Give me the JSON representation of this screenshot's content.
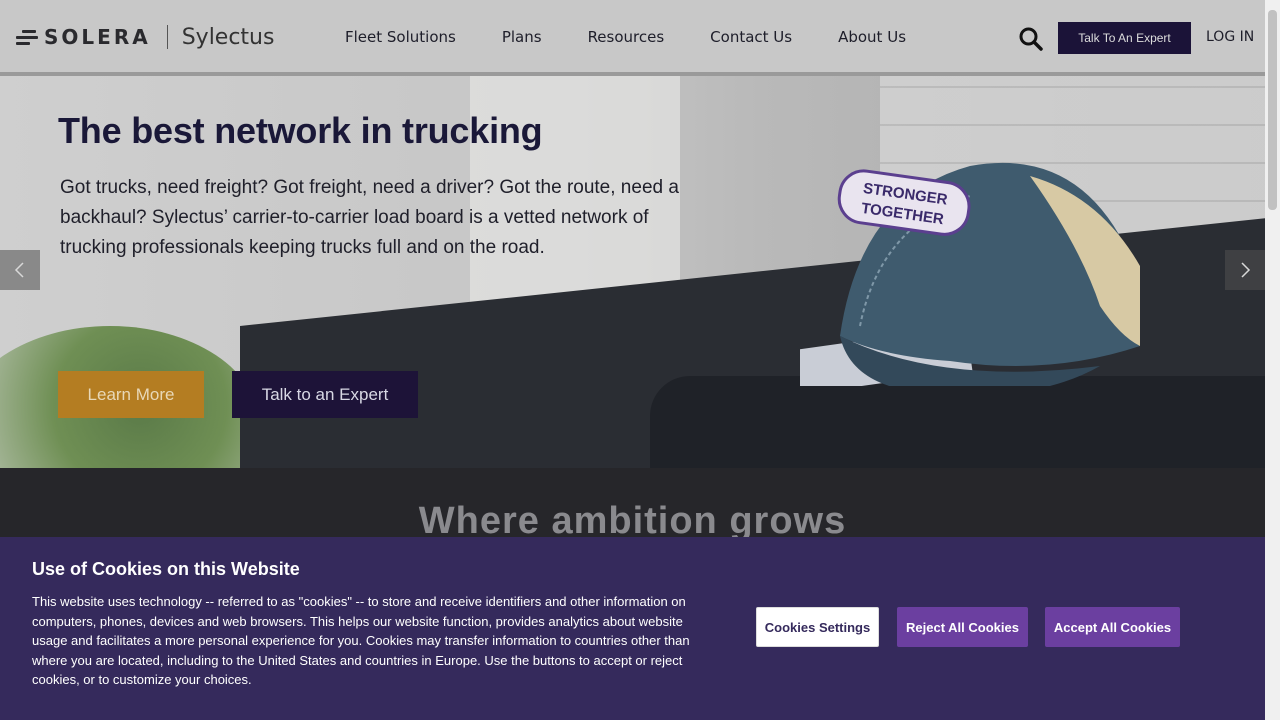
{
  "header": {
    "logo_word": "SOLERA",
    "logo_sub": "Sylectus",
    "nav": [
      "Fleet Solutions",
      "Plans",
      "Resources",
      "Contact Us",
      "About Us"
    ],
    "search_icon": "search-icon",
    "talk_button": "Talk To An Expert",
    "login": "LOG IN"
  },
  "hero": {
    "title": "The best network in trucking",
    "text": "Got trucks, need freight? Got freight, need a driver? Got the route, need a backhaul? Sylectus’ carrier-to-carrier load board is a vetted network of trucking professionals keeping trucks full and on the road.",
    "learn_more": "Learn More",
    "talk_expert": "Talk to an Expert",
    "cap_patch": [
      "STRONGER",
      "TOGETHER"
    ]
  },
  "section": {
    "title": "Where ambition grows"
  },
  "cookie": {
    "title": "Use of Cookies on this Website",
    "text": "This website uses technology -- referred to as \"cookies\" -- to store and receive identifiers and other information on computers, phones, devices and web browsers. This helps our website function, provides analytics about website usage and facilitates a more personal experience for you. Cookies may transfer information to countries other than where you are located, including to the United States and countries in Europe. Use the buttons to accept or reject cookies, or to customize your choices.",
    "settings": "Cookies Settings",
    "reject": "Reject All Cookies",
    "accept": "Accept All Cookies"
  },
  "colors": {
    "brand_navy": "#1b1338",
    "accent_gold": "#b47d22",
    "cookie_bg": "#352a5c",
    "cookie_button": "#6b3fa0"
  }
}
